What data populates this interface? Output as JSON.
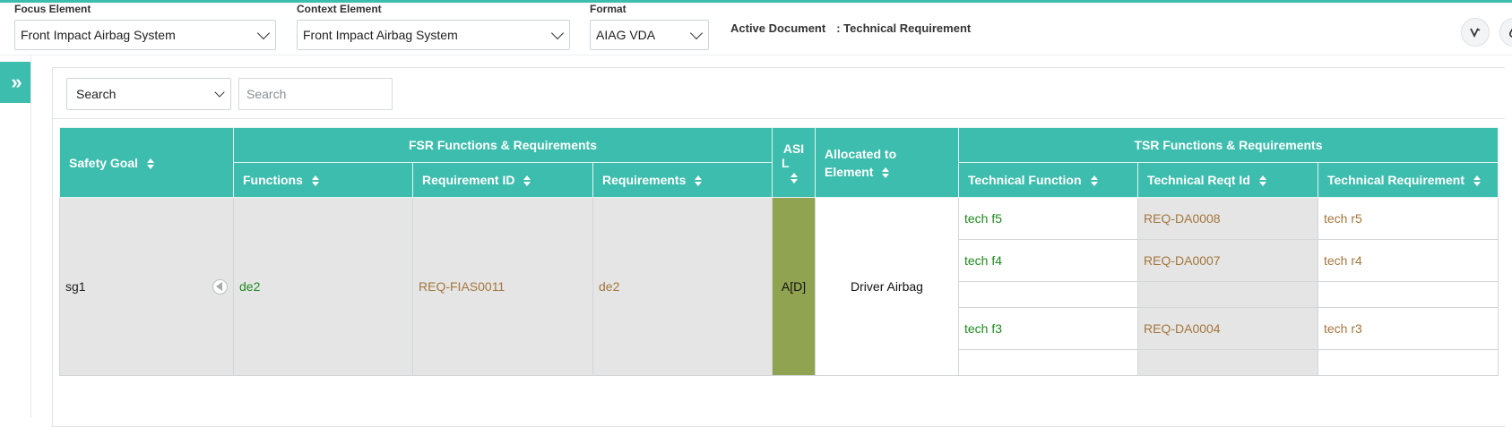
{
  "header": {
    "focus_label": "Focus Element",
    "focus_value": "Front Impact Airbag System",
    "context_label": "Context Element",
    "context_value": "Front Impact Airbag System",
    "format_label": "Format",
    "format_value": "AIAG VDA",
    "active_doc_label": "Active Document",
    "active_doc_value": ": Technical Requirement"
  },
  "sidebar": {
    "expand_glyph": "»"
  },
  "search": {
    "field_selected": "Search",
    "placeholder": "Search"
  },
  "table": {
    "group_headers": {
      "fsr": "FSR Functions & Requirements",
      "tsr": "TSR Functions & Requirements"
    },
    "columns": {
      "safety_goal": "Safety Goal",
      "functions": "Functions",
      "requirement_id": "Requirement ID",
      "requirements": "Requirements",
      "asil_line1": "ASI",
      "asil_line2": "L",
      "allocated_line1": "Allocated to",
      "allocated_line2": "Element",
      "tech_function": "Technical Function",
      "tech_reqt_id": "Technical Reqt Id",
      "tech_requirement": "Technical Requirement"
    },
    "row": {
      "safety_goal": "sg1",
      "function": "de2",
      "requirement_id": "REQ-FIAS0011",
      "requirement": "de2",
      "asil": "A[D]",
      "allocated": "Driver Airbag",
      "tech_rows": [
        {
          "function": "tech f5",
          "reqt_id": "REQ-DA0008",
          "requirement": "tech r5"
        },
        {
          "function": "tech f4",
          "reqt_id": "REQ-DA0007",
          "requirement": "tech r4"
        },
        {
          "function": "",
          "reqt_id": "",
          "requirement": ""
        },
        {
          "function": "tech f3",
          "reqt_id": "REQ-DA0004",
          "requirement": "tech r3"
        },
        {
          "function": "",
          "reqt_id": "",
          "requirement": ""
        }
      ]
    }
  },
  "colors": {
    "accent": "#3dbdad",
    "asil_bg": "#8fa350",
    "function_text": "#1e8a1e",
    "requirement_text": "#a4763d"
  }
}
